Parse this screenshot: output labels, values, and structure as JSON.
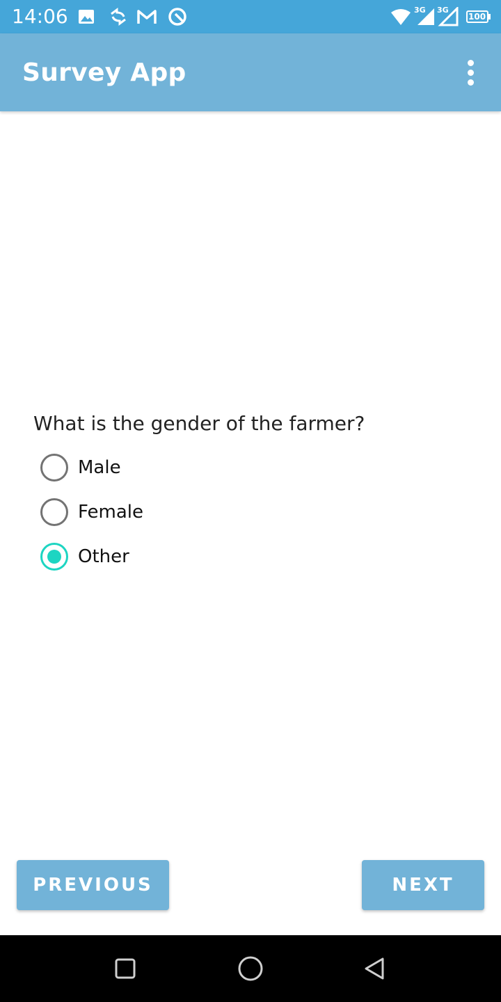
{
  "status_bar": {
    "time": "14:06",
    "left_icons": [
      "image-icon",
      "sync-icon",
      "gmail-icon",
      "q-icon"
    ],
    "right_icons": [
      "wifi-icon",
      "signal-3g-icon",
      "signal-3g-icon",
      "battery-icon"
    ],
    "network_label_1": "3G",
    "network_label_2": "3G",
    "battery_level": "100"
  },
  "app_bar": {
    "title": "Survey App",
    "menu_icon": "more-vertical-icon"
  },
  "question": {
    "text": "What is the gender of the farmer?",
    "options": [
      {
        "label": "Male",
        "selected": false
      },
      {
        "label": "Female",
        "selected": false
      },
      {
        "label": "Other",
        "selected": true
      }
    ]
  },
  "buttons": {
    "previous": "PREVIOUS",
    "next": "NEXT"
  },
  "nav": {
    "recents_icon": "square-icon",
    "home_icon": "circle-icon",
    "back_icon": "triangle-back-icon"
  },
  "colors": {
    "status_bar": "#45a6d9",
    "primary": "#72b3d8",
    "accent": "#1dd5c2"
  }
}
